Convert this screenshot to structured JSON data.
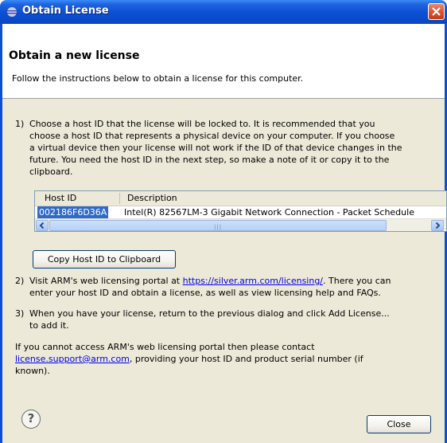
{
  "window": {
    "title": "Obtain License",
    "close_glyph": "✕"
  },
  "header": {
    "heading": "Obtain a new license",
    "description": "Follow the instructions below to obtain a license for this computer."
  },
  "steps": [
    {
      "num": "1)",
      "lines": [
        "Choose a host ID that the license will be locked to. It is recommended that you",
        "choose a host ID that represents a physical device on your computer. If you choose",
        "a virtual device then your license will not work if the ID of that device changes in the",
        "future. You need the host ID in the next step, so make a note of it or copy it to the",
        "clipboard."
      ]
    },
    {
      "num": "2)",
      "line1_before": "Visit ARM's web licensing portal at ",
      "link": "https://silver.arm.com/licensing/",
      "line1_after": ". There you can",
      "line2": "enter your host ID and obtain a license, as well as view licensing help and FAQs."
    },
    {
      "num": "3)",
      "lines": [
        "When you have your license, return to the previous dialog and click Add License...",
        "to add it."
      ]
    }
  ],
  "table": {
    "columns": [
      "Host ID",
      "Description"
    ],
    "rows": [
      {
        "host_id": "002186F6D36A",
        "description": "Intel(R) 82567LM-3 Gigabit Network Connection - Packet Schedule"
      }
    ],
    "scroll_grip": "|||"
  },
  "copy_button": "Copy Host ID to Clipboard",
  "footer": {
    "line1": "If you cannot access ARM's web licensing portal then please contact",
    "email": "license.support@arm.com",
    "line2_after": ", providing your host ID and product serial number (if",
    "line3": "known)."
  },
  "help_glyph": "?",
  "close_button": "Close",
  "colors": {
    "titlebar": "#0a4fd4",
    "selection": "#316ac5",
    "dialog_bg": "#ece9d8",
    "link": "#0000ee"
  }
}
